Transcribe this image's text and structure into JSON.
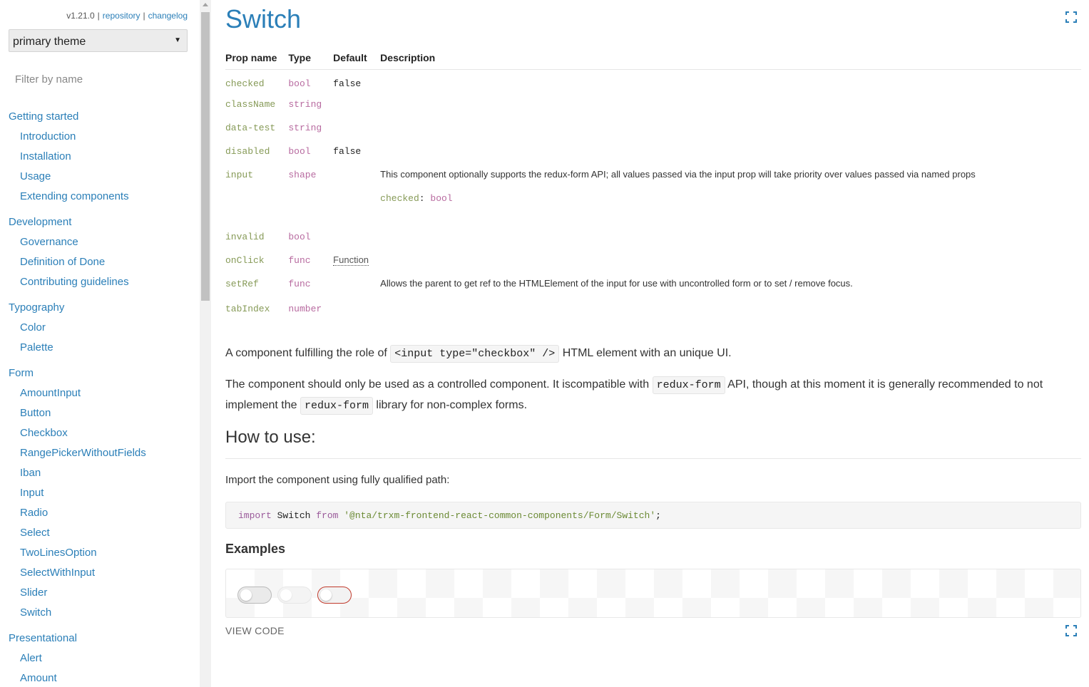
{
  "sidebar": {
    "version": "v1.21.0",
    "repository_link": "repository",
    "changelog_link": "changelog",
    "theme_select_value": "primary theme",
    "filter_placeholder": "Filter by name",
    "groups": [
      {
        "title": "Getting started",
        "items": [
          "Introduction",
          "Installation",
          "Usage",
          "Extending components"
        ]
      },
      {
        "title": "Development",
        "items": [
          "Governance",
          "Definition of Done",
          "Contributing guidelines"
        ]
      },
      {
        "title": "Typography",
        "items": [
          "Color",
          "Palette"
        ]
      },
      {
        "title": "Form",
        "items": [
          "AmountInput",
          "Button",
          "Checkbox",
          "RangePickerWithoutFields",
          "Iban",
          "Input",
          "Radio",
          "Select",
          "TwoLinesOption",
          "SelectWithInput",
          "Slider",
          "Switch"
        ]
      },
      {
        "title": "Presentational",
        "items": [
          "Alert",
          "Amount"
        ]
      }
    ]
  },
  "main": {
    "title": "Switch",
    "props_table": {
      "headers": [
        "Prop name",
        "Type",
        "Default",
        "Description"
      ],
      "rows": [
        {
          "name": "checked",
          "type": "bool",
          "default": "false",
          "description": ""
        },
        {
          "name": "className",
          "type": "string",
          "default": "",
          "description": ""
        },
        {
          "name": "data-test",
          "type": "string",
          "default": "",
          "description": ""
        },
        {
          "name": "disabled",
          "type": "bool",
          "default": "false",
          "description": ""
        },
        {
          "name": "input",
          "type": "shape",
          "default": "",
          "description": "This component optionally supports the redux-form API; all values passed via the input prop will take priority over values passed via named props",
          "sub_prop_name": "checked",
          "sub_prop_sep": ": ",
          "sub_prop_type": "bool"
        },
        {
          "name": "invalid",
          "type": "bool",
          "default": "",
          "description": ""
        },
        {
          "name": "onClick",
          "type": "func",
          "default": "Function",
          "description": ""
        },
        {
          "name": "setRef",
          "type": "func",
          "default": "",
          "description": "Allows the parent to get ref to the HTMLElement of the input for use with uncontrolled form or to set / remove focus."
        },
        {
          "name": "tabIndex",
          "type": "number",
          "default": "",
          "description": ""
        }
      ]
    },
    "intro": {
      "prefix": "A component fulfilling the role of ",
      "code": "<input type=\"checkbox\" />",
      "suffix": " HTML element with an unique UI."
    },
    "usage_note": {
      "part1": "The component should only be used as a controlled component. It iscompatible with ",
      "code1": "redux-form",
      "part2": " API, though at this moment it is generally recommended to not implement the ",
      "code2": "redux-form",
      "part3": " library for non-complex forms."
    },
    "how_to_use_heading": "How to use:",
    "import_label": "Import the component using fully qualified path:",
    "import_code": {
      "kw_import": "import",
      "name": " Switch ",
      "kw_from": "from",
      "path": " '@nta/trxm-frontend-react-common-components/Form/Switch'",
      "end": ";"
    },
    "examples_heading": "Examples",
    "examples": [
      {
        "state": "unchecked"
      },
      {
        "state": "disabled"
      },
      {
        "state": "invalid"
      }
    ],
    "view_code_label": "VIEW CODE"
  },
  "colors": {
    "link": "#2b7fb8",
    "prop_name": "#869a57",
    "prop_type": "#b86ba0",
    "invalid_border": "#c0392b"
  }
}
